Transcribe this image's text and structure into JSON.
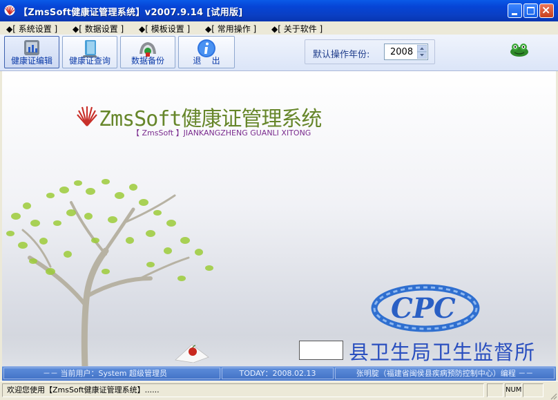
{
  "window": {
    "title": "【ZmsSoft健康证管理系统】v2007.9.14 [试用版]"
  },
  "menu": [
    "◆[ 系统设置 ]",
    "◆[ 数据设置 ]",
    "◆[ 模板设置 ]",
    "◆[ 常用操作 ]",
    "◆[ 关于软件 ]"
  ],
  "toolbar": {
    "buttons": [
      {
        "label": "健康证编辑",
        "icon": "health-card-edit-icon"
      },
      {
        "label": "健康证查询",
        "icon": "health-card-query-icon"
      },
      {
        "label": "数据备份",
        "icon": "data-backup-icon"
      },
      {
        "label": "退    出",
        "icon": "info-exit-icon"
      }
    ],
    "year_label": "默认操作年份:",
    "year_value": "2008"
  },
  "main": {
    "product_title": "ZmsSoft健康证管理系统",
    "product_subtitle": "【 ZmsSoft 】JIANKANGZHENG GUANLI XITONG",
    "org_name": "县卫生局卫生监督所"
  },
  "infobar": {
    "user": "－－   当前用户：System     超级管理员",
    "today": "TODAY：2008.02.13",
    "author": "张明腚（福建省闽侯县疾病预防控制中心）编程   －－"
  },
  "status": {
    "message": "欢迎您使用【ZmsSoft健康证管理系统】......",
    "num": "NUM"
  },
  "colors": {
    "titlebar": "#0a5ae8",
    "title_green": "#66862a",
    "subtitle_purple": "#7a2b8e",
    "org_blue": "#2a4fbf",
    "info_band": "#4f7fd0"
  }
}
